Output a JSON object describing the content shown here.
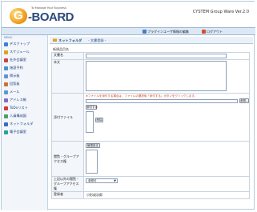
{
  "app": {
    "tagline": "To Manage Your Business",
    "logo_letter": "G",
    "logo_name": "-BOARD",
    "version": "CYSTEM Group Ware Ver.2.0"
  },
  "navbar": {
    "preferences": "プラグインユーザ情報の編集",
    "logout": "ログアウト"
  },
  "sidebar": {
    "title": "MENU",
    "items": [
      {
        "label": "デスクトップ",
        "color": "#3b7dd8"
      },
      {
        "label": "スケジュール",
        "color": "#e0a020"
      },
      {
        "label": "社外会議室",
        "color": "#d04040"
      },
      {
        "label": "施設予約",
        "color": "#4a90d0"
      },
      {
        "label": "掲示板",
        "color": "#6a8fd0"
      },
      {
        "label": "回覧板",
        "color": "#d07030"
      },
      {
        "label": "メール",
        "color": "#5a9ad0"
      },
      {
        "label": "アドレス帳",
        "color": "#8a6ac0"
      },
      {
        "label": "ToDoリスト",
        "color": "#d03a3a"
      },
      {
        "label": "人員構成図",
        "color": "#4aa060"
      },
      {
        "label": "ネットフォルダ",
        "color": "#3a6ac0"
      },
      {
        "label": "電子会議室",
        "color": "#2aa0a0"
      }
    ]
  },
  "crumb": {
    "current": "ネットフォルダ",
    "sub": "- 文書登録 -"
  },
  "section_title": "新規品目名",
  "form": {
    "title_label": "文書名",
    "body_label": "本文",
    "file_label": "添付ファイル",
    "file_notice": "※ファイルを添付する場合は、ファイルの選択後「添付する」ボタンをクリックします。",
    "browse_button": "参照...",
    "attach_button": "添付する",
    "remove_button": "削除",
    "access_label": "閲覧・グループアクセス権",
    "access_button": "権限設定",
    "upper_label": "上記以外の閲覧・グループアクセス権",
    "upper_select": "参照可",
    "registrant_label": "登録者",
    "registrant_value": "小形成次郎"
  }
}
